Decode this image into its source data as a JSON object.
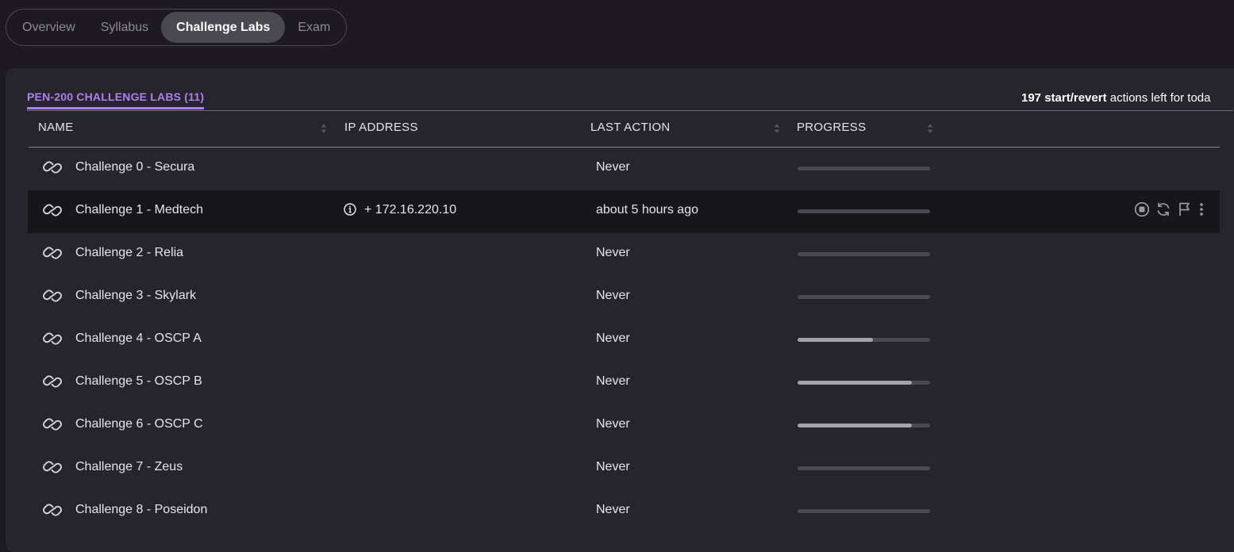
{
  "tabs": [
    {
      "label": "Overview"
    },
    {
      "label": "Syllabus"
    },
    {
      "label": "Challenge Labs"
    },
    {
      "label": "Exam"
    }
  ],
  "panel": {
    "title": "PEN-200 CHALLENGE LABS (11)",
    "actions_count_label": "197 start/revert",
    "actions_suffix": " actions left for toda"
  },
  "table": {
    "columns": {
      "name": "NAME",
      "ip": "IP ADDRESS",
      "last_action": "LAST ACTION",
      "progress": "PROGRESS"
    },
    "rows": [
      {
        "name": "Challenge 0 - Secura",
        "ip": "",
        "last_action": "Never",
        "progress": 0
      },
      {
        "name": "Challenge 1 - Medtech",
        "ip": "+ 172.16.220.10",
        "last_action": "about 5 hours ago",
        "progress": 0
      },
      {
        "name": "Challenge 2 - Relia",
        "ip": "",
        "last_action": "Never",
        "progress": 0
      },
      {
        "name": "Challenge 3 - Skylark",
        "ip": "",
        "last_action": "Never",
        "progress": 0
      },
      {
        "name": "Challenge 4 - OSCP A",
        "ip": "",
        "last_action": "Never",
        "progress": 0.57
      },
      {
        "name": "Challenge 5 - OSCP B",
        "ip": "",
        "last_action": "Never",
        "progress": 0.86
      },
      {
        "name": "Challenge 6 - OSCP C",
        "ip": "",
        "last_action": "Never",
        "progress": 0.86
      },
      {
        "name": "Challenge 7 - Zeus",
        "ip": "",
        "last_action": "Never",
        "progress": 0
      },
      {
        "name": "Challenge 8 - Poseidon",
        "ip": "",
        "last_action": "Never",
        "progress": 0
      }
    ]
  },
  "colors": {
    "background": "#1d1b21",
    "panel": "#27252c",
    "accent": "#b07ff0",
    "active_row": "#17161a",
    "progress_track": "#4a4850",
    "progress_fill": "#a5a3aa"
  },
  "icons": {
    "row": "link-icon",
    "ip": "info-icon",
    "actions": [
      "stop-icon",
      "revert-icon",
      "flag-icon",
      "more-vertical-icon"
    ]
  }
}
